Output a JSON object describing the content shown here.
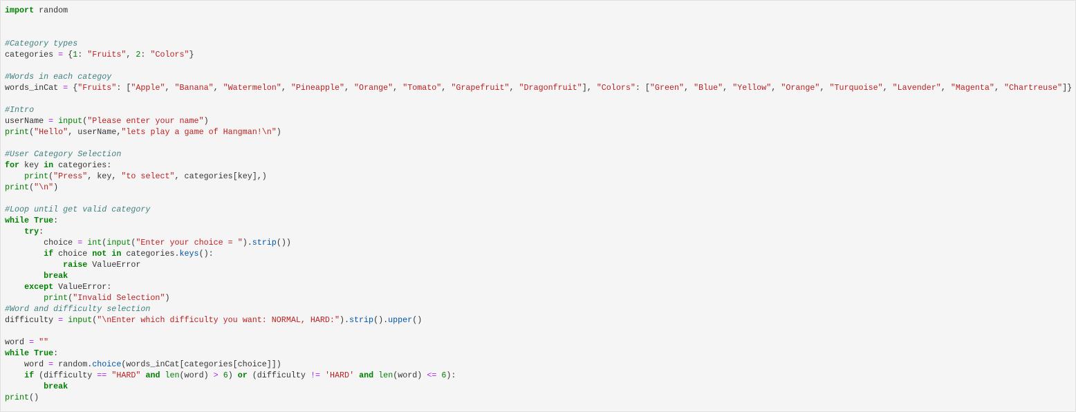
{
  "cell": {
    "lines": [
      [
        [
          "kw",
          "import"
        ],
        [
          "p",
          " random"
        ]
      ],
      [],
      [],
      [
        [
          "cm",
          "#Category types"
        ]
      ],
      [
        [
          "p",
          "categories "
        ],
        [
          "op",
          "="
        ],
        [
          "p",
          " {"
        ],
        [
          "num",
          "1"
        ],
        [
          "p",
          ": "
        ],
        [
          "str",
          "\"Fruits\""
        ],
        [
          "p",
          ", "
        ],
        [
          "num",
          "2"
        ],
        [
          "p",
          ": "
        ],
        [
          "str",
          "\"Colors\""
        ],
        [
          "p",
          "}"
        ]
      ],
      [],
      [
        [
          "cm",
          "#Words in each categoy"
        ]
      ],
      [
        [
          "p",
          "words_inCat "
        ],
        [
          "op",
          "="
        ],
        [
          "p",
          " {"
        ],
        [
          "str",
          "\"Fruits\""
        ],
        [
          "p",
          ": ["
        ],
        [
          "str",
          "\"Apple\""
        ],
        [
          "p",
          ", "
        ],
        [
          "str",
          "\"Banana\""
        ],
        [
          "p",
          ", "
        ],
        [
          "str",
          "\"Watermelon\""
        ],
        [
          "p",
          ", "
        ],
        [
          "str",
          "\"Pineapple\""
        ],
        [
          "p",
          ", "
        ],
        [
          "str",
          "\"Orange\""
        ],
        [
          "p",
          ", "
        ],
        [
          "str",
          "\"Tomato\""
        ],
        [
          "p",
          ", "
        ],
        [
          "str",
          "\"Grapefruit\""
        ],
        [
          "p",
          ", "
        ],
        [
          "str",
          "\"Dragonfruit\""
        ],
        [
          "p",
          "], "
        ],
        [
          "str",
          "\"Colors\""
        ],
        [
          "p",
          ": ["
        ],
        [
          "str",
          "\"Green\""
        ],
        [
          "p",
          ", "
        ],
        [
          "str",
          "\"Blue\""
        ],
        [
          "p",
          ", "
        ],
        [
          "str",
          "\"Yellow\""
        ],
        [
          "p",
          ", "
        ],
        [
          "str",
          "\"Orange\""
        ],
        [
          "p",
          ", "
        ],
        [
          "str",
          "\"Turquoise\""
        ],
        [
          "p",
          ", "
        ],
        [
          "str",
          "\"Lavender\""
        ],
        [
          "p",
          ", "
        ],
        [
          "str",
          "\"Magenta\""
        ],
        [
          "p",
          ", "
        ],
        [
          "str",
          "\"Chartreuse\""
        ],
        [
          "p",
          "]}"
        ]
      ],
      [],
      [
        [
          "cm",
          "#Intro"
        ]
      ],
      [
        [
          "p",
          "userName "
        ],
        [
          "op",
          "="
        ],
        [
          "p",
          " "
        ],
        [
          "bi",
          "input"
        ],
        [
          "p",
          "("
        ],
        [
          "str",
          "\"Please enter your name\""
        ],
        [
          "p",
          ")"
        ]
      ],
      [
        [
          "bi",
          "print"
        ],
        [
          "p",
          "("
        ],
        [
          "str",
          "\"Hello\""
        ],
        [
          "p",
          ", userName,"
        ],
        [
          "str",
          "\"lets play a game of Hangman!\\n\""
        ],
        [
          "p",
          ")"
        ]
      ],
      [],
      [
        [
          "cm",
          "#User Category Selection"
        ]
      ],
      [
        [
          "kw",
          "for"
        ],
        [
          "p",
          " key "
        ],
        [
          "kw",
          "in"
        ],
        [
          "p",
          " categories:"
        ]
      ],
      [
        [
          "p",
          "    "
        ],
        [
          "bi",
          "print"
        ],
        [
          "p",
          "("
        ],
        [
          "str",
          "\"Press\""
        ],
        [
          "p",
          ", key, "
        ],
        [
          "str",
          "\"to select\""
        ],
        [
          "p",
          ", categories[key],)"
        ]
      ],
      [
        [
          "bi",
          "print"
        ],
        [
          "p",
          "("
        ],
        [
          "str",
          "\"\\n\""
        ],
        [
          "p",
          ")"
        ]
      ],
      [],
      [
        [
          "cm",
          "#Loop until get valid category"
        ]
      ],
      [
        [
          "kw",
          "while"
        ],
        [
          "p",
          " "
        ],
        [
          "kw",
          "True"
        ],
        [
          "p",
          ":"
        ]
      ],
      [
        [
          "p",
          "    "
        ],
        [
          "kw",
          "try"
        ],
        [
          "p",
          ":"
        ]
      ],
      [
        [
          "p",
          "        choice "
        ],
        [
          "op",
          "="
        ],
        [
          "p",
          " "
        ],
        [
          "bi",
          "int"
        ],
        [
          "p",
          "("
        ],
        [
          "bi",
          "input"
        ],
        [
          "p",
          "("
        ],
        [
          "str",
          "\"Enter your choice = \""
        ],
        [
          "p",
          ")."
        ],
        [
          "fn",
          "strip"
        ],
        [
          "p",
          "())"
        ]
      ],
      [
        [
          "p",
          "        "
        ],
        [
          "kw",
          "if"
        ],
        [
          "p",
          " choice "
        ],
        [
          "kw",
          "not in"
        ],
        [
          "p",
          " categories."
        ],
        [
          "fn",
          "keys"
        ],
        [
          "p",
          "():"
        ]
      ],
      [
        [
          "p",
          "            "
        ],
        [
          "kw",
          "raise"
        ],
        [
          "p",
          " ValueError"
        ]
      ],
      [
        [
          "p",
          "        "
        ],
        [
          "kw",
          "break"
        ]
      ],
      [
        [
          "p",
          "    "
        ],
        [
          "kw",
          "except"
        ],
        [
          "p",
          " ValueError:"
        ]
      ],
      [
        [
          "p",
          "        "
        ],
        [
          "bi",
          "print"
        ],
        [
          "p",
          "("
        ],
        [
          "str",
          "\"Invalid Selection\""
        ],
        [
          "p",
          ")"
        ]
      ],
      [
        [
          "cm",
          "#Word and difficulty selection"
        ]
      ],
      [
        [
          "p",
          "difficulty "
        ],
        [
          "op",
          "="
        ],
        [
          "p",
          " "
        ],
        [
          "bi",
          "input"
        ],
        [
          "p",
          "("
        ],
        [
          "str",
          "\"\\nEnter which difficulty you want: NORMAL, HARD:\""
        ],
        [
          "p",
          ")."
        ],
        [
          "fn",
          "strip"
        ],
        [
          "p",
          "()."
        ],
        [
          "fn",
          "upper"
        ],
        [
          "p",
          "()"
        ]
      ],
      [],
      [
        [
          "p",
          "word "
        ],
        [
          "op",
          "="
        ],
        [
          "p",
          " "
        ],
        [
          "str",
          "\"\""
        ]
      ],
      [
        [
          "kw",
          "while"
        ],
        [
          "p",
          " "
        ],
        [
          "kw",
          "True"
        ],
        [
          "p",
          ":"
        ]
      ],
      [
        [
          "p",
          "    word "
        ],
        [
          "op",
          "="
        ],
        [
          "p",
          " random."
        ],
        [
          "fn",
          "choice"
        ],
        [
          "p",
          "(words_inCat[categories[choice]])"
        ]
      ],
      [
        [
          "p",
          "    "
        ],
        [
          "kw",
          "if"
        ],
        [
          "p",
          " (difficulty "
        ],
        [
          "op",
          "=="
        ],
        [
          "p",
          " "
        ],
        [
          "str",
          "\"HARD\""
        ],
        [
          "p",
          " "
        ],
        [
          "kw",
          "and"
        ],
        [
          "p",
          " "
        ],
        [
          "bi",
          "len"
        ],
        [
          "p",
          "(word) "
        ],
        [
          "op",
          ">"
        ],
        [
          "p",
          " "
        ],
        [
          "num",
          "6"
        ],
        [
          "p",
          ") "
        ],
        [
          "kw",
          "or"
        ],
        [
          "p",
          " (difficulty "
        ],
        [
          "op",
          "!="
        ],
        [
          "p",
          " "
        ],
        [
          "str",
          "'HARD'"
        ],
        [
          "p",
          " "
        ],
        [
          "kw",
          "and"
        ],
        [
          "p",
          " "
        ],
        [
          "bi",
          "len"
        ],
        [
          "p",
          "(word) "
        ],
        [
          "op",
          "<="
        ],
        [
          "p",
          " "
        ],
        [
          "num",
          "6"
        ],
        [
          "p",
          "):"
        ]
      ],
      [
        [
          "p",
          "        "
        ],
        [
          "kw",
          "break"
        ]
      ],
      [
        [
          "bi",
          "print"
        ],
        [
          "p",
          "()"
        ]
      ]
    ]
  }
}
